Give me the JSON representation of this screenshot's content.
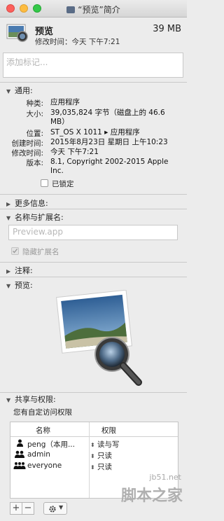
{
  "window": {
    "title": "“预览”简介"
  },
  "header": {
    "app_name": "预览",
    "app_size": "39 MB",
    "modified": "修改时间：今天 下午7:21"
  },
  "tags": {
    "placeholder": "添加标记..."
  },
  "general": {
    "heading": "通用:",
    "rows": [
      {
        "key": "种类:",
        "value": "应用程序"
      },
      {
        "key": "大小:",
        "value": "39,035,824 字节（磁盘上的 46.6 MB）"
      },
      {
        "key": "位置:",
        "value": "ST_OS X 1011 ▸ 应用程序"
      },
      {
        "key": "创建时间:",
        "value": "2015年8月23日 星期日 上午10:23"
      },
      {
        "key": "修改时间:",
        "value": "今天 下午7:21"
      },
      {
        "key": "版本:",
        "value": "8.1, Copyright 2002-2015 Apple Inc."
      }
    ],
    "locked_label": "已锁定"
  },
  "more_info": {
    "heading": "更多信息:"
  },
  "name_ext": {
    "heading": "名称与扩展名:",
    "input_placeholder": "Preview.app",
    "hide_ext_label": "隐藏扩展名"
  },
  "comments": {
    "heading": "注释:"
  },
  "preview": {
    "heading": "预览:"
  },
  "sharing": {
    "heading": "共享与权限:",
    "subtitle": "您有自定访问权限",
    "columns": [
      "名称",
      "权限"
    ],
    "rows": [
      {
        "name": "peng（本用...",
        "priv": "读与写",
        "icon": "user-icon"
      },
      {
        "name": "admin",
        "priv": "只读",
        "icon": "group-icon"
      },
      {
        "name": "everyone",
        "priv": "只读",
        "icon": "everyone-icon"
      }
    ]
  },
  "toolbar": {
    "add_label": "+",
    "remove_label": "−"
  },
  "watermark": {
    "line1": "jb51.net",
    "line2": "脚本之家"
  }
}
